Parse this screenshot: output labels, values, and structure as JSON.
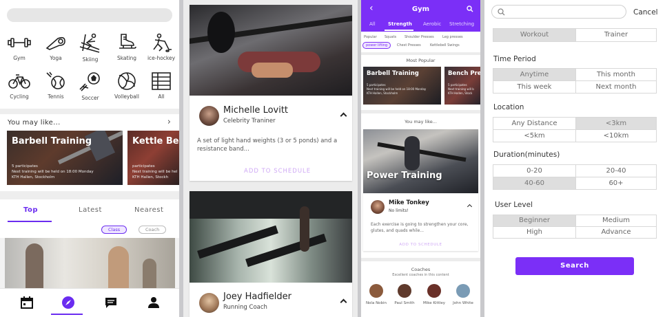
{
  "home": {
    "sports": [
      {
        "label": "Gym",
        "icon": "dumbbell-icon"
      },
      {
        "label": "Yoga",
        "icon": "yoga-mat-icon"
      },
      {
        "label": "Skiing",
        "icon": "skier-icon"
      },
      {
        "label": "Skating",
        "icon": "skate-icon"
      },
      {
        "label": "ice-hockey",
        "icon": "hockey-icon"
      },
      {
        "label": "Cycling",
        "icon": "bicycle-icon"
      },
      {
        "label": "Tennis",
        "icon": "tennis-ball-icon"
      },
      {
        "label": "Soccer",
        "icon": "soccer-ball-icon"
      },
      {
        "label": "Volleyball",
        "icon": "volleyball-icon"
      },
      {
        "label": "All",
        "icon": "grid-list-icon"
      }
    ],
    "you_may_like_title": "You may like...",
    "cards": [
      {
        "title": "Barbell Training",
        "participants": "5 participates",
        "next": "Next training will be held on 18:00 Monday",
        "place": "KTH Hallen, Stockholm"
      },
      {
        "title": "Kettle Bell",
        "participants": "participates",
        "next": "Next training will be hel",
        "place": "KTH Hallen, Stockh"
      }
    ],
    "tabs": [
      "Top",
      "Latest",
      "Nearest"
    ],
    "chips": [
      "Class",
      "Coach"
    ],
    "nav_icons": [
      "calendar-icon",
      "compass-icon",
      "chat-icon",
      "profile-icon"
    ]
  },
  "trainers": [
    {
      "name": "Michelle Lovitt",
      "role": "Celebrity Traniner",
      "desc": "A set of light hand weights (3 or 5 ponds) and a resistance band...",
      "action": "ADD TO SCHEDULE"
    },
    {
      "name": "Joey Hadfielder",
      "role": "Running Coach"
    }
  ],
  "gym": {
    "title": "Gym",
    "tabs": [
      "All",
      "Strength",
      "Aerobic",
      "Stretching"
    ],
    "subs_row1": [
      "Popular",
      "Squats",
      "Shoulder Presses",
      "Leg presses"
    ],
    "subs_row2": [
      "power lifting",
      "Chest Presses",
      "Kettlebell Swings"
    ],
    "most_popular": "Most Popular",
    "mini_cards": [
      {
        "title": "Barbell Training",
        "participants": "5 participates",
        "next": "Next training will be held on 18:00 Monday",
        "place": "KTH Hallen, Stockholm"
      },
      {
        "title": "Bench Pres",
        "participants": "5 participates",
        "next": "Next training will b",
        "place": "KTH Hallen, Stock"
      }
    ],
    "you_may_like": "You may like...",
    "power": {
      "title": "Power Training",
      "coach": "Mike Tonkey",
      "tagline": "No limits!",
      "desc": "Each exercise is going to strengthen your core, glutes, and quads while...",
      "action": "ADD TO SCHEDULE"
    },
    "coaches_title": "Coaches",
    "coaches_sub": "Excellent coaches in this content",
    "coaches": [
      "Nola Nobin",
      "Paul Smith",
      "Mike Kittley",
      "John White"
    ]
  },
  "filter": {
    "cancel": "Cancel",
    "type": [
      "Workout",
      "Trainer"
    ],
    "time_label": "Time Period",
    "time": [
      "Anytime",
      "This month",
      "This week",
      "Next month"
    ],
    "location_label": "Location",
    "location": [
      "Any Distance",
      "<3km",
      "<5km",
      "<10km"
    ],
    "duration_label": "Duration(minutes)",
    "duration": [
      "0-20",
      "20-40",
      "40-60",
      "60+"
    ],
    "level_label": "User Level",
    "level": [
      "Beginner",
      "Medium",
      "High",
      "Advance"
    ],
    "search": "Search"
  }
}
